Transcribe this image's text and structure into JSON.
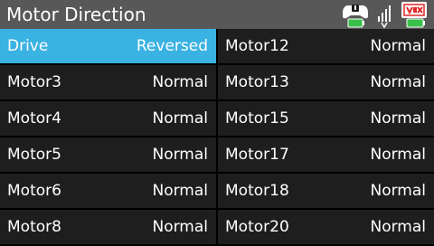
{
  "header": {
    "title": "Motor Direction",
    "icons": [
      "controller-battery-icon",
      "signal-strength-icon",
      "brain-battery-icon"
    ]
  },
  "colors": {
    "title_bar": "#585858",
    "row_bg": "#1e1e1e",
    "selected_bg": "#3ab2e2",
    "text": "#ffffff",
    "battery_green": "#38c04a",
    "vex_red": "#e22a2a"
  },
  "left_column": [
    {
      "name": "Drive",
      "value": "Reversed",
      "selected": true
    },
    {
      "name": "Motor3",
      "value": "Normal",
      "selected": false
    },
    {
      "name": "Motor4",
      "value": "Normal",
      "selected": false
    },
    {
      "name": "Motor5",
      "value": "Normal",
      "selected": false
    },
    {
      "name": "Motor6",
      "value": "Normal",
      "selected": false
    },
    {
      "name": "Motor8",
      "value": "Normal",
      "selected": false
    }
  ],
  "right_column": [
    {
      "name": "Motor12",
      "value": "Normal",
      "selected": false
    },
    {
      "name": "Motor13",
      "value": "Normal",
      "selected": false
    },
    {
      "name": "Motor15",
      "value": "Normal",
      "selected": false
    },
    {
      "name": "Motor17",
      "value": "Normal",
      "selected": false
    },
    {
      "name": "Motor18",
      "value": "Normal",
      "selected": false
    },
    {
      "name": "Motor20",
      "value": "Normal",
      "selected": false
    }
  ]
}
